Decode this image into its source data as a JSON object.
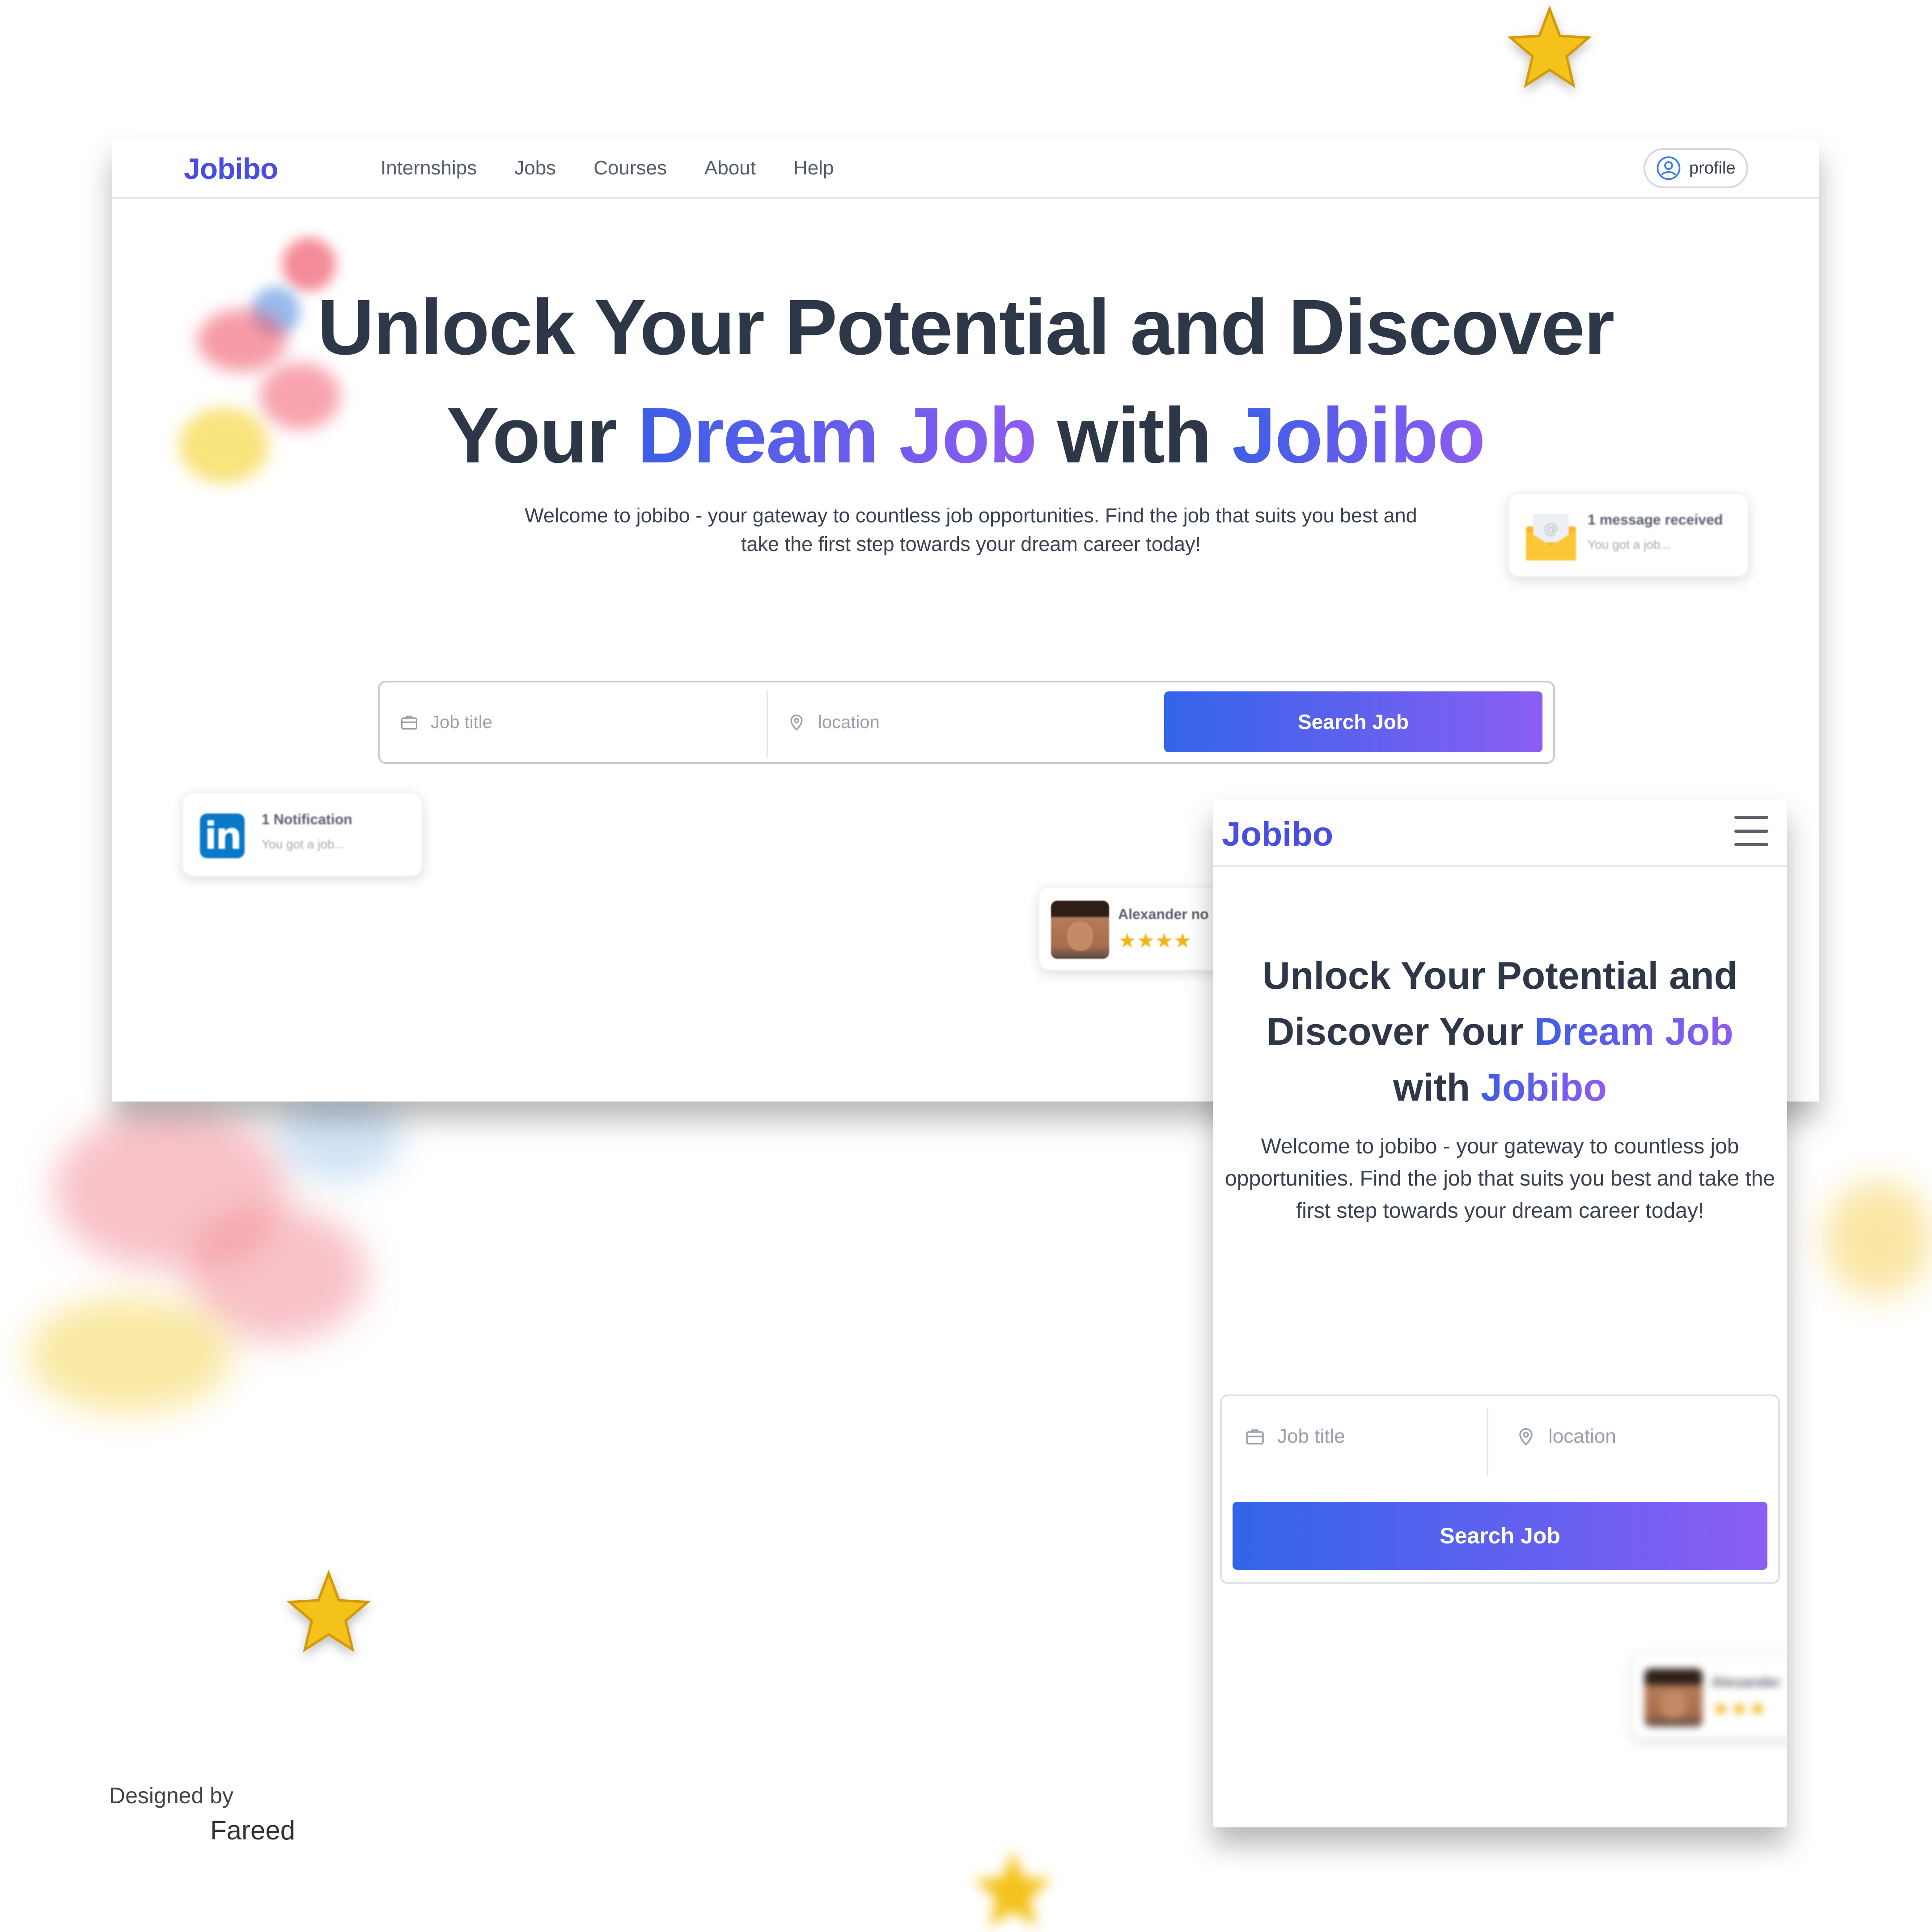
{
  "desktop": {
    "logo": "Jobibo",
    "nav_items": [
      "Internships",
      "Jobs",
      "Courses",
      "About",
      "Help"
    ],
    "profile_label": "profile",
    "headline": {
      "line1": "Unlock Your Potential and Discover",
      "line2_a": "Your ",
      "line2_b": "Dream Job",
      "line2_c": " with ",
      "line2_d": "Jobibo"
    },
    "subtitle": "Welcome to jobibo - your gateway to countless job opportunities. Find the job that suits you best and take the first step towards your dream career today!",
    "message_toast": {
      "title": "1 message received",
      "body": "You got a job..."
    },
    "notification_toast": {
      "title": "1 Notification",
      "body": "You got a job..."
    },
    "review_toast": {
      "name": "Alexander no",
      "stars": "★★★★"
    },
    "search": {
      "job_placeholder": "Job title",
      "location_placeholder": "location",
      "button_label": "Search Job"
    }
  },
  "mobile": {
    "logo": "Jobibo",
    "headline": {
      "line1": "Unlock Your Potential and",
      "line2_a": "Discover Your ",
      "line2_b": "Dream Job",
      "line3_a": "with ",
      "line3_b": "Jobibo"
    },
    "subtitle": "Welcome to jobibo - your gateway to countless job opportunities. Find the job that suits you best and take the first step towards your dream career today!",
    "search": {
      "job_placeholder": "Job title",
      "location_placeholder": "location",
      "button_label": "Search Job"
    },
    "review_toast": {
      "name": "Alexander",
      "stars": "★★★"
    }
  },
  "credit": {
    "line1": "Designed by",
    "line2": "Fareed"
  },
  "colors": {
    "brand": "#4a4ee0",
    "gradient_start": "#3264ea",
    "gradient_end": "#8a5ef3",
    "heading": "#2d3748"
  }
}
